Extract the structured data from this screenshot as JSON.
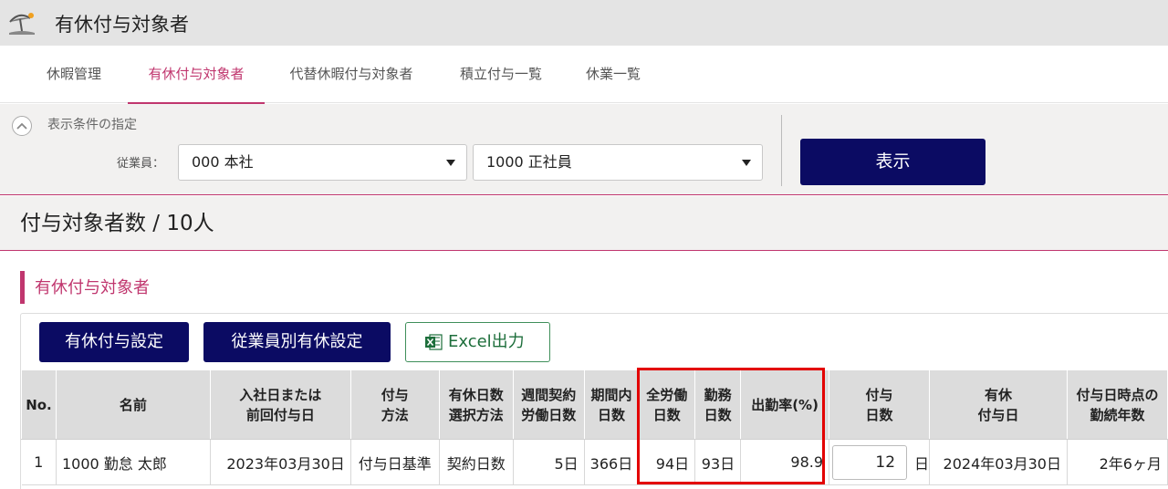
{
  "app": {
    "title": "有休付与対象者",
    "icon": "beach-umbrella-icon"
  },
  "tabs": [
    {
      "label": "休暇管理"
    },
    {
      "label": "有休付与対象者"
    },
    {
      "label": "代替休暇付与対象者"
    },
    {
      "label": "積立付与一覧"
    },
    {
      "label": "休業一覧"
    }
  ],
  "filter": {
    "heading": "表示条件の指定",
    "employee_label": "従業員：",
    "branch_value": "000 本社",
    "type_value": "1000 正社員",
    "show_button": "表示"
  },
  "summary": {
    "count_text": "付与対象者数 / 10人"
  },
  "section": {
    "title": "有休付与対象者",
    "btn_grant_setting": "有休付与設定",
    "btn_employee_setting": "従業員別有休設定",
    "btn_excel": "Excel出力"
  },
  "table": {
    "headers": [
      {
        "l1": "No.",
        "l2": ""
      },
      {
        "l1": "名前",
        "l2": ""
      },
      {
        "l1": "入社日または",
        "l2": "前回付与日"
      },
      {
        "l1": "付与",
        "l2": "方法"
      },
      {
        "l1": "有休日数",
        "l2": "選択方法"
      },
      {
        "l1": "週間契約",
        "l2": "労働日数"
      },
      {
        "l1": "期間内",
        "l2": "日数"
      },
      {
        "l1": "全労働",
        "l2": "日数"
      },
      {
        "l1": "勤務",
        "l2": "日数"
      },
      {
        "l1": "出勤率(%)",
        "l2": ""
      },
      {
        "l1": "付与",
        "l2": "日数"
      },
      {
        "l1": "有休",
        "l2": "付与日"
      },
      {
        "l1": "付与日時点の",
        "l2": "勤続年数"
      }
    ],
    "rows": [
      {
        "no": "1",
        "name": "1000 勤怠 太郎",
        "prev_date": "2023年03月30日",
        "method": "付与日基準",
        "select_method": "契約日数",
        "weekly_days": "5日",
        "period_days": "366日",
        "total_work_days": "94日",
        "attend_days": "93日",
        "rate": "98.9",
        "grant_days": "12",
        "grant_unit": "日",
        "grant_date": "2024年03月30日",
        "tenure": "2年6ヶ月"
      }
    ]
  },
  "colors": {
    "accent": "#c0366e",
    "navy": "#0b0b63",
    "highlight": "#e30000",
    "excel_green": "#1d6e3b"
  }
}
